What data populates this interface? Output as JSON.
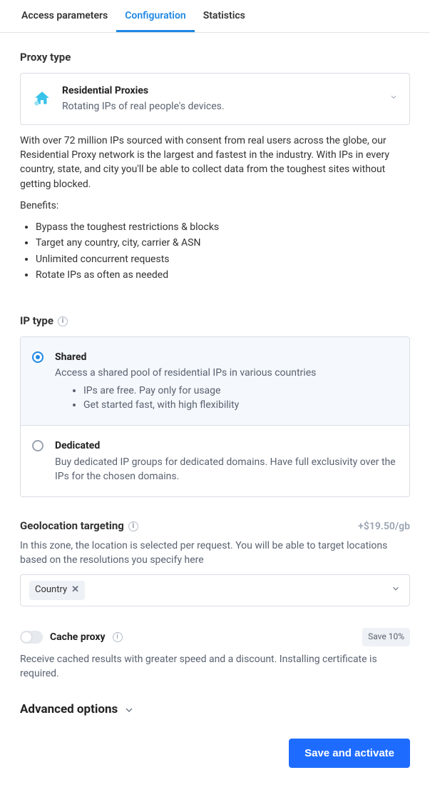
{
  "tabs": {
    "access": "Access parameters",
    "configuration": "Configuration",
    "statistics": "Statistics"
  },
  "proxy_type": {
    "heading": "Proxy type",
    "option": {
      "title": "Residential Proxies",
      "subtitle": "Rotating IPs of real people's devices."
    },
    "description": "With over 72 million IPs sourced with consent from real users across the globe, our Residential Proxy network is the largest and fastest in the industry. With IPs in every country, state, and city you'll be able to collect data from the toughest sites without getting blocked.",
    "benefits_label": "Benefits:",
    "benefits": [
      "Bypass the toughest restrictions & blocks",
      "Target any country, city, carrier & ASN",
      "Unlimited concurrent requests",
      "Rotate IPs as often as needed"
    ]
  },
  "ip_type": {
    "heading": "IP type",
    "options": [
      {
        "title": "Shared",
        "subtitle": "Access a shared pool of residential IPs in various countries",
        "bullets": [
          "IPs are free. Pay only for usage",
          "Get started fast, with high flexibility"
        ],
        "selected": true
      },
      {
        "title": "Dedicated",
        "subtitle": "Buy dedicated IP groups for dedicated domains. Have full exclusivity over the IPs for the chosen domains.",
        "bullets": [],
        "selected": false
      }
    ]
  },
  "geolocation": {
    "heading": "Geolocation targeting",
    "price": "+$19.50/gb",
    "description": "In this zone, the location is selected per request. You will be able to target locations based on the resolutions you specify here",
    "chip": "Country"
  },
  "cache_proxy": {
    "heading": "Cache proxy",
    "badge": "Save 10%",
    "description": "Receive cached results with greater speed and a discount. Installing certificate is required.",
    "enabled": false
  },
  "advanced": {
    "heading": "Advanced options"
  },
  "footer": {
    "cta": "Save and activate"
  }
}
